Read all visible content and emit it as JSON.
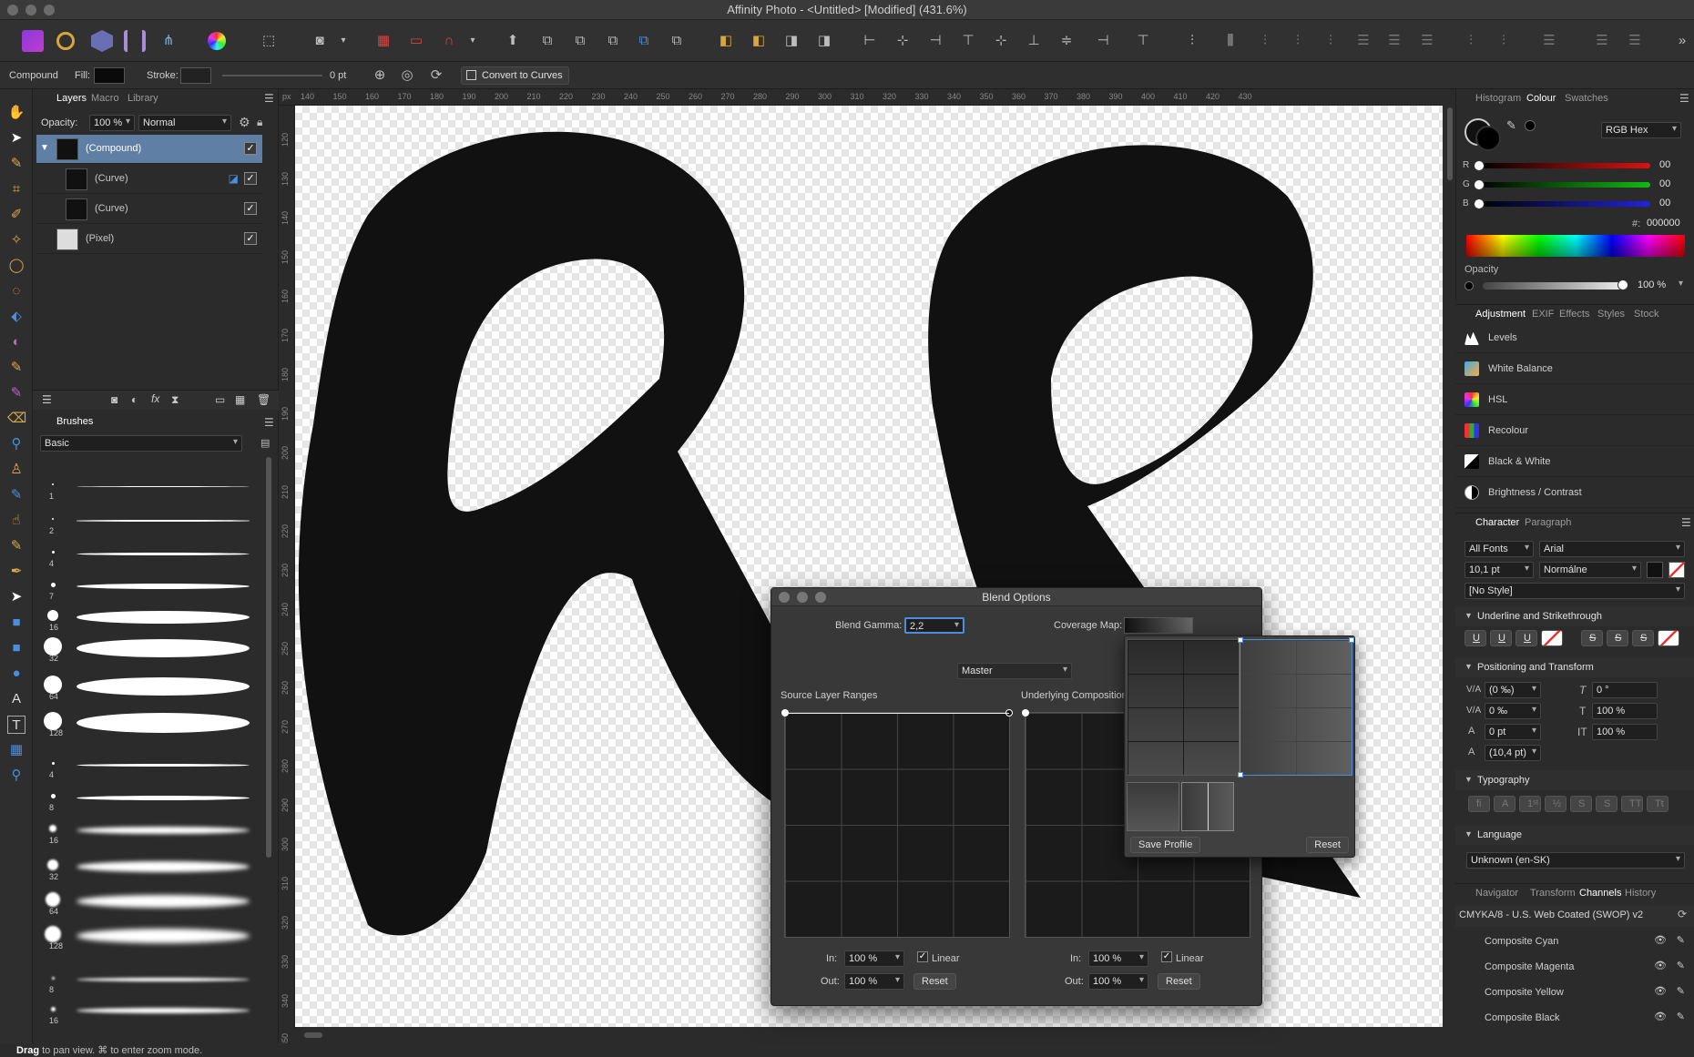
{
  "window": {
    "title": "Affinity Photo - <Untitled> [Modified] (431.6%)"
  },
  "contextbar": {
    "tool_name": "Compound",
    "fill_label": "Fill:",
    "stroke_label": "Stroke:",
    "stroke_width": "0 pt",
    "convert_label": "Convert to Curves"
  },
  "layers_panel": {
    "tabs": [
      "Layers",
      "Macro",
      "Library"
    ],
    "opacity_label": "Opacity:",
    "opacity_value": "100 %",
    "blend_mode": "Normal",
    "rows": [
      {
        "name": "(Compound)",
        "selected": true
      },
      {
        "name": "(Curve)"
      },
      {
        "name": "(Curve)"
      },
      {
        "name": "(Pixel)"
      }
    ]
  },
  "brushes_panel": {
    "tab": "Brushes",
    "category": "Basic",
    "sizes": [
      "1",
      "2",
      "4",
      "7",
      "16",
      "32",
      "64",
      "128",
      "4",
      "8",
      "16",
      "32",
      "64",
      "128",
      "8",
      "16"
    ]
  },
  "rulers": {
    "top": [
      "140",
      "150",
      "160",
      "170",
      "180",
      "190",
      "200",
      "210",
      "220",
      "230",
      "240",
      "250",
      "260",
      "270",
      "280",
      "290",
      "300",
      "310",
      "320",
      "330",
      "340",
      "350",
      "360",
      "370",
      "380",
      "390",
      "400",
      "410",
      "420",
      "430"
    ],
    "unit": "px",
    "left": [
      "120",
      "130",
      "140",
      "150",
      "160",
      "170",
      "180",
      "190",
      "200",
      "210",
      "220",
      "230",
      "240",
      "250",
      "260",
      "270",
      "280",
      "290",
      "300",
      "310",
      "320",
      "330",
      "340",
      "350"
    ]
  },
  "colour_panel": {
    "tabs": [
      "Histogram",
      "Colour",
      "Swatches"
    ],
    "mode": "RGB Hex",
    "channels": [
      {
        "label": "R",
        "value": "00",
        "color": "#d11"
      },
      {
        "label": "G",
        "value": "00",
        "color": "#1b1"
      },
      {
        "label": "B",
        "value": "00",
        "color": "#22d"
      }
    ],
    "hex_label": "#:",
    "hex_value": "000000",
    "opacity_label": "Opacity",
    "opacity_value": "100 %"
  },
  "adjustment_panel": {
    "tabs": [
      "Adjustment",
      "EXIF",
      "Effects",
      "Styles",
      "Stock"
    ],
    "items": [
      "Levels",
      "White Balance",
      "HSL",
      "Recolour",
      "Black & White",
      "Brightness / Contrast"
    ]
  },
  "character_panel": {
    "tabs": [
      "Character",
      "Paragraph"
    ],
    "font_collection": "All Fonts",
    "font_family": "Arial",
    "font_size": "10,1 pt",
    "font_style": "Normálne",
    "style": "[No Style]",
    "sections": {
      "underline": "Underline and Strikethrough",
      "positioning": "Positioning and Transform",
      "typography": "Typography",
      "language": "Language"
    },
    "positioning_values": {
      "tracking": "(0 ‰)",
      "kerning": "0 ‰",
      "baseline": "0 pt",
      "leading": "(10,4 pt)",
      "shear": "0 °",
      "scale_v": "100 %",
      "scale_h": "100 %"
    },
    "language_value": "Unknown (en-SK)"
  },
  "channels_panel": {
    "tabs": [
      "Navigator",
      "Transform",
      "Channels",
      "History"
    ],
    "profile": "CMYKA/8 - U.S. Web Coated (SWOP) v2",
    "channels": [
      "Composite Cyan",
      "Composite Magenta",
      "Composite Yellow",
      "Composite Black"
    ]
  },
  "blend_dialog": {
    "title": "Blend Options",
    "gamma_label": "Blend Gamma:",
    "gamma_value": "2,2",
    "coverage_label": "Coverage Map:",
    "channel": "Master",
    "source_label": "Source Layer Ranges",
    "underlying_label": "Underlying Composition",
    "in_label": "In:",
    "out_label": "Out:",
    "in_value": "100 %",
    "out_value": "100 %",
    "linear_label": "Linear",
    "reset_label": "Reset",
    "save_profile_label": "Save Profile"
  },
  "statusbar": {
    "bold": "Drag",
    "rest": " to pan view. ⌘ to enter zoom mode."
  }
}
